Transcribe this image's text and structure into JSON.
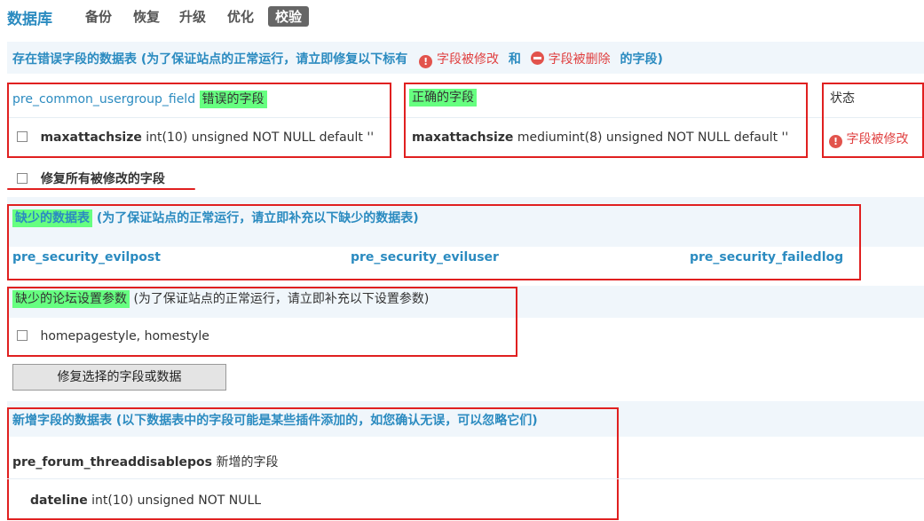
{
  "nav": {
    "title": "数据库",
    "tabs": [
      "备份",
      "恢复",
      "升级",
      "优化",
      "校验"
    ]
  },
  "errors": {
    "header_text": "存在错误字段的数据表 (为了保证站点的正常运行，请立即修复以下标有",
    "tag_modified": "字段被修改",
    "conjunction": "和",
    "tag_deleted": "字段被删除",
    "header_tail": "的字段)",
    "table_name": "pre_common_usergroup_field",
    "wrong_label": "错误的字段",
    "correct_label": "正确的字段",
    "status_label": "状态",
    "wrong_field_name": "maxattachsize",
    "wrong_field_def": "int(10) unsigned NOT NULL default ''",
    "correct_field_name": "maxattachsize",
    "correct_field_def": "mediumint(8) unsigned NOT NULL default ''",
    "status_value": "字段被修改",
    "fix_all_label": "修复所有被修改的字段"
  },
  "missing_tables": {
    "title": "缺少的数据表",
    "note": "(为了保证站点的正常运行，请立即补充以下缺少的数据表)",
    "items": [
      "pre_security_evilpost",
      "pre_security_eviluser",
      "pre_security_failedlog"
    ]
  },
  "missing_settings": {
    "title": "缺少的论坛设置参数",
    "note": "(为了保证站点的正常运行，请立即补充以下设置参数)",
    "value": "homepagestyle, homestyle"
  },
  "repair_button": "修复选择的字段或数据",
  "new_fields": {
    "header": "新增字段的数据表 (以下数据表中的字段可能是某些插件添加的，如您确认无误，可以忽略它们)",
    "table_name": "pre_forum_threaddisablepos",
    "table_suffix": "新增的字段",
    "field_name": "dateline",
    "field_def": "int(10) unsigned NOT NULL"
  }
}
